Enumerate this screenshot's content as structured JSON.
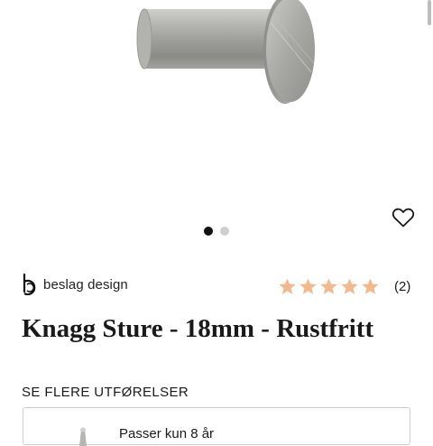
{
  "product": {
    "brand": "beslag design",
    "title": "Knagg Sture - 18mm - Rustfritt",
    "rating": {
      "value": 5,
      "max": 5,
      "count_label": "(2)",
      "star_color": "#f2b98f"
    }
  },
  "gallery": {
    "image_count": 2,
    "active_index": 0,
    "image_description_icon": "stainless-steel-hook-photo"
  },
  "variants": {
    "section_label": "SE FLERE UTFØRELSER",
    "first_item_label": "Passer kun 8 år"
  },
  "icons": {
    "wishlist": "heart-outline-icon",
    "brand_logo": "beslag-design-logo-icon"
  },
  "colors": {
    "text": "#1a1a1a",
    "star": "#f2b98f",
    "dot_active": "#111111",
    "dot_inactive": "#cfcfcf"
  }
}
